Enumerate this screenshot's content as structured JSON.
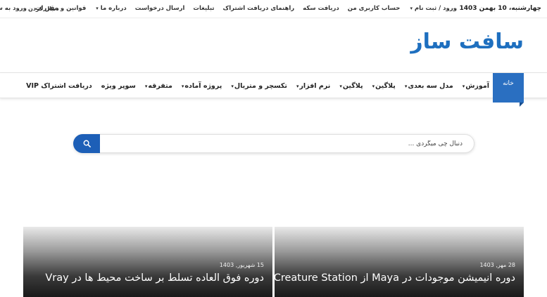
{
  "topbar": {
    "date": "چهارشنبه، 10 بهمن 1403",
    "links": [
      {
        "label": "ورود / ثبت نام",
        "caret": true
      },
      {
        "label": "حساب کاربری من",
        "caret": false
      },
      {
        "label": "دریافت سکه",
        "caret": false
      },
      {
        "label": "راهنمای دریافت اشتراک",
        "caret": false
      },
      {
        "label": "تبلیغات",
        "caret": false
      },
      {
        "label": "ارسال درخواست",
        "caret": false
      },
      {
        "label": "درباره ما",
        "caret": true
      },
      {
        "label": "قوانین و مقررات",
        "caret": false
      },
      {
        "label": "ورود به سایت",
        "caret": false
      }
    ],
    "follow": "دنبال کردن"
  },
  "logo": "سافت ساز",
  "mainnav": {
    "home": "خانه",
    "items": [
      {
        "label": "آموزش",
        "caret": true
      },
      {
        "label": "مدل سه بعدی",
        "caret": true
      },
      {
        "label": "پلاگین",
        "caret": true
      },
      {
        "label": "پلاگین",
        "caret": true
      },
      {
        "label": "نرم افزار",
        "caret": true
      },
      {
        "label": "تکسچر و متریال",
        "caret": true
      },
      {
        "label": "پروژه آماده",
        "caret": true
      },
      {
        "label": "متفرقه",
        "caret": true
      },
      {
        "label": "سوپر ویژه",
        "caret": false
      },
      {
        "label": "دریافت اشتراک VIP",
        "caret": false
      }
    ]
  },
  "search": {
    "placeholder": "دنبال چی میگردی ..."
  },
  "cards": [
    {
      "date": "28 مهر, 1403",
      "title": "دوره انیمیشن موجودات در Maya از Creature Station"
    },
    {
      "date": "15 شهریور, 1403",
      "title": "دوره فوق العاده تسلط بر ساخت محیط ها در Vray"
    }
  ],
  "icons": {
    "search": "search-icon",
    "caret": "chevron-down-icon"
  },
  "colors": {
    "brand": "#1e6fbf",
    "home_tab": "#2a6fc1",
    "search_button": "#1d5fb7"
  }
}
